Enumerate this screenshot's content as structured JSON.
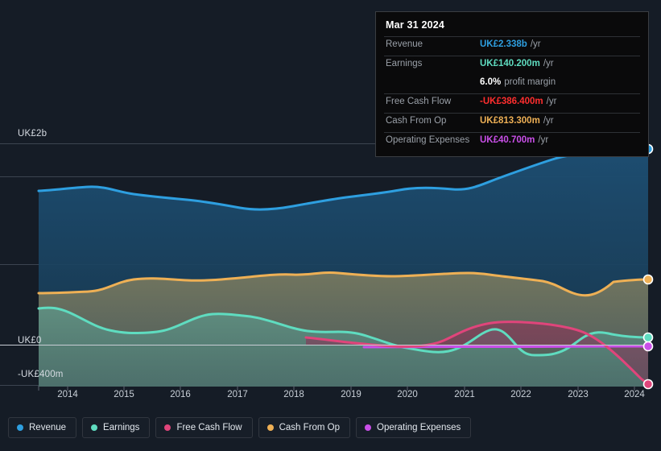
{
  "tooltip": {
    "date": "Mar 31 2024",
    "rows": [
      {
        "key": "Revenue",
        "value": "UK£2.338b",
        "unit": "/yr"
      },
      {
        "key": "Earnings",
        "value": "UK£140.200m",
        "unit": "/yr"
      },
      {
        "key": "",
        "value": "6.0%",
        "unit": "profit margin"
      },
      {
        "key": "Free Cash Flow",
        "value": "-UK£386.400m",
        "unit": "/yr"
      },
      {
        "key": "Cash From Op",
        "value": "UK£813.300m",
        "unit": "/yr"
      },
      {
        "key": "Operating Expenses",
        "value": "UK£40.700m",
        "unit": "/yr"
      }
    ]
  },
  "axis": {
    "y_top": "UK£2b",
    "y_zero": "UK£0",
    "y_bottom": "-UK£400m"
  },
  "legend": {
    "items": [
      {
        "label": "Revenue",
        "color": "#2e9fe0"
      },
      {
        "label": "Earnings",
        "color": "#5fdcc0"
      },
      {
        "label": "Free Cash Flow",
        "color": "#e0457b"
      },
      {
        "label": "Cash From Op",
        "color": "#eeb055"
      },
      {
        "label": "Operating Expenses",
        "color": "#c94fe8"
      }
    ]
  },
  "chart_data": {
    "type": "area",
    "title": "",
    "xlabel": "",
    "ylabel": "",
    "currency": "UK£",
    "units": "millions",
    "grid": true,
    "legend_position": "bottom",
    "ylim": [
      -400,
      2600
    ],
    "ytick_values": [
      2000,
      0,
      -400
    ],
    "ytick_labels": [
      "UK£2b",
      "UK£0",
      "-UK£400m"
    ],
    "categories": [
      "2014",
      "2015",
      "2016",
      "2017",
      "2018",
      "2019",
      "2020",
      "2021",
      "2022",
      "2023",
      "2024"
    ],
    "x": [
      2014,
      2015,
      2016,
      2017,
      2018,
      2019,
      2020,
      2021,
      2022,
      2023,
      2024
    ],
    "highlight_band": {
      "from": "2023.0",
      "to": "2024.4",
      "label": ""
    },
    "series": [
      {
        "name": "Revenue",
        "color": "#2e9fe0",
        "values": [
          1450,
          1430,
          1390,
          1370,
          1420,
          1470,
          1530,
          1560,
          1720,
          1980,
          2338
        ]
      },
      {
        "name": "Earnings",
        "color": "#5fdcc0",
        "values": [
          290,
          170,
          130,
          195,
          215,
          180,
          145,
          90,
          -45,
          80,
          140.2
        ]
      },
      {
        "name": "Free Cash Flow",
        "color": "#e0457b",
        "values": [
          null,
          null,
          null,
          null,
          20,
          -35,
          -55,
          50,
          120,
          60,
          -386.4
        ]
      },
      {
        "name": "Cash From Op",
        "color": "#eeb055",
        "values": [
          780,
          880,
          870,
          900,
          930,
          960,
          930,
          940,
          900,
          790,
          813.3
        ]
      },
      {
        "name": "Operating Expenses",
        "color": "#c94fe8",
        "values": [
          null,
          null,
          null,
          null,
          null,
          42,
          42,
          42,
          42,
          41,
          40.7
        ]
      }
    ]
  }
}
